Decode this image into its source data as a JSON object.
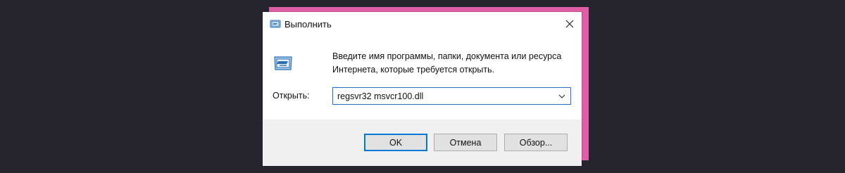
{
  "window": {
    "title": "Выполнить",
    "icon": "run-icon",
    "close_icon": "close-icon"
  },
  "content": {
    "description": "Введите имя программы, папки, документа или ресурса Интернета, которые требуется открыть.",
    "icon": "run-icon"
  },
  "open_field": {
    "label": "Открыть:",
    "value": "regsvr32 msvcr100.dll",
    "dropdown_icon": "chevron-down-icon"
  },
  "buttons": {
    "ok": "OK",
    "cancel": "Отмена",
    "browse": "Обзор..."
  },
  "colors": {
    "background": "#26252e",
    "accent_card": "#e05ea8",
    "focus_border": "#0078d7"
  }
}
